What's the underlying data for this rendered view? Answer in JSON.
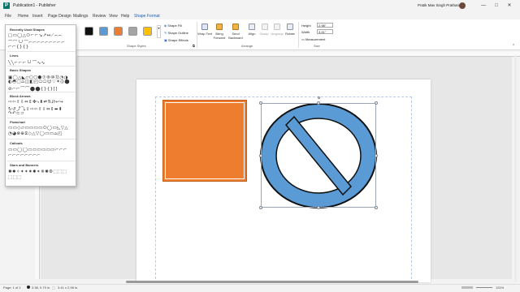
{
  "window": {
    "title": "Publication1 - Publisher",
    "app_icon": "P",
    "user": "Pratik Mav Singh Prathan",
    "controls": [
      "—",
      "□",
      "✕"
    ]
  },
  "menu": {
    "tabs": [
      "File",
      "Home",
      "Insert",
      "Page Design",
      "Mailings",
      "Review",
      "View",
      "Help",
      "Shape Format"
    ],
    "active": "Shape Format"
  },
  "ribbon": {
    "shape_styles": {
      "swatch_colors": [
        "#111111",
        "#5b9bd5",
        "#ed7d31",
        "#a5a5a5",
        "#ffc000"
      ],
      "shape_fill": "Shape Fill",
      "shape_outline": "Shape Outline",
      "shape_effects": "Shape Effects",
      "group_label": "Shape Styles"
    },
    "arrange": {
      "wrap_text": "Wrap Text",
      "bring_forward": "Bring Forward",
      "send_backward": "Send Backward",
      "align": "Align",
      "group": "Group",
      "ungroup": "Ungroup",
      "rotate": "Rotate",
      "group_label": "Arrange"
    },
    "size": {
      "height_label": "Height",
      "height_value": "2.98\"",
      "width_label": "Width",
      "width_value": "3.41\"",
      "measurement": "Measurement",
      "group_label": "Size"
    }
  },
  "gallery": {
    "sections": [
      {
        "title": "Recently Used Shapes",
        "rows": [
          "▢▭◯△⬭⌐⌐↘↗↔⟋⌒⌒",
          "⌒⌒╰╯⌒⌐⌐⌐⌐⌐⌐⌐⌐⌐",
          "⌐⌐{}{}"
        ]
      },
      {
        "title": "Lines",
        "rows": [
          "╲╲⌐⌐⌐╰╯⌒∿∿"
        ]
      },
      {
        "title": "Basic Shapes",
        "rows": [
          "▣◯△◣▱⬠⬡⬢⑦⑧⑩⑫◔◑",
          "◐◓▢⌓◫◧◰⬭⬭☺♡✶◎⬤",
          "⊘⌐⌐⌒⌒⬤⬤{}{}[]"
        ]
      },
      {
        "title": "Block Arrows",
        "rows": [
          "⇨⇦⇧⇩⇔⇕✥⤷⬍⮂⮁⮃↩↪",
          "↻↺⤴⤵⇪⇨⇦⇧⇩⇔⇕⬌⬍",
          "↷↶⊂⊃"
        ]
      },
      {
        "title": "Flowchart",
        "rows": [
          "▭▭◇▱▭▭▭▭⬭◯▭◺▽△",
          "◔◕⊗⊕⧖◇△▽◯▭▭⌓◰"
        ]
      },
      {
        "title": "Callouts",
        "rows": [
          "▭▭◯◯▭▭▭▭▭▭⌐⌐⌐",
          "⌐⌐⌐⌐⌐⌐⌐⌐"
        ]
      },
      {
        "title": "Stars and Banners",
        "rows": [
          "✺✹✧✦✶✷✸✴✵✺⚙⬚⬚⬚",
          "⬚⬚⬚"
        ]
      }
    ]
  },
  "status": {
    "page": "Page: 1 of 1",
    "position": "3.38, 0.79 in.",
    "size": "3.41 x 2.98 in.",
    "zoom": "131%"
  },
  "canvas": {
    "shape1_color": "#ee7d2f",
    "shape2_fill": "#5b9bd5",
    "shape2_stroke": "#111111"
  }
}
